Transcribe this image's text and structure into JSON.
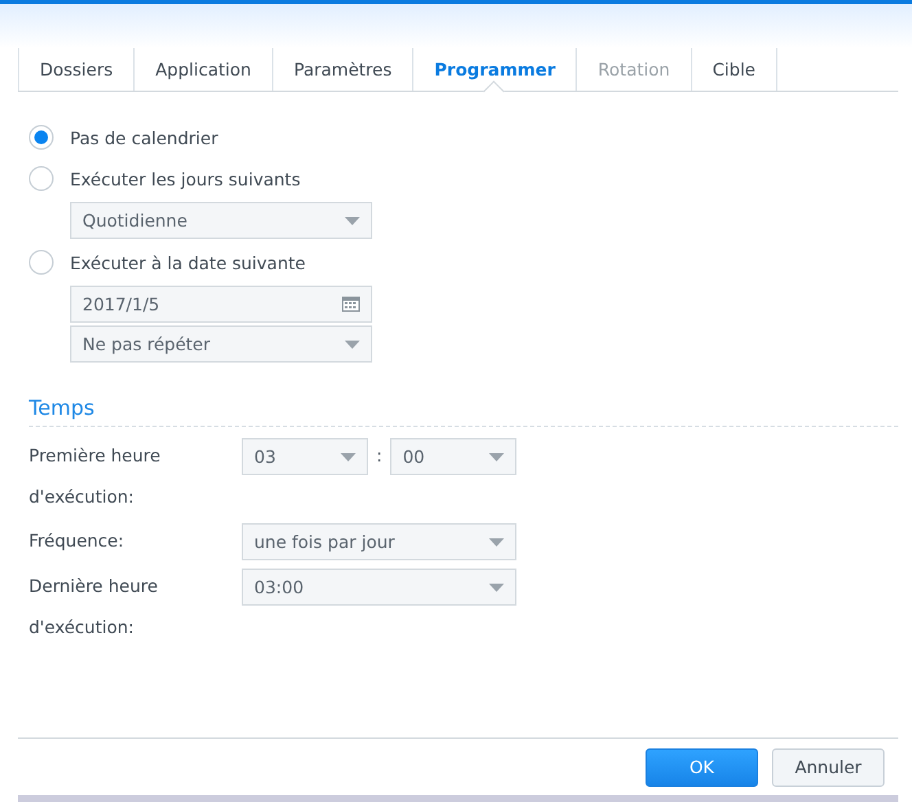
{
  "tabs": [
    {
      "label": "Dossiers",
      "selected": false,
      "disabled": false
    },
    {
      "label": "Application",
      "selected": false,
      "disabled": false
    },
    {
      "label": "Paramètres",
      "selected": false,
      "disabled": false
    },
    {
      "label": "Programmer",
      "selected": true,
      "disabled": false
    },
    {
      "label": "Rotation",
      "selected": false,
      "disabled": true
    },
    {
      "label": "Cible",
      "selected": false,
      "disabled": false
    }
  ],
  "schedule": [
    {
      "label": "Pas de calendrier",
      "selected": true
    },
    {
      "label": "Exécuter les jours suivants",
      "selected": false,
      "fields": [
        {
          "kind": "dropdown",
          "value": "Quotidienne"
        }
      ]
    },
    {
      "label": "Exécuter à la date suivante",
      "selected": false,
      "fields": [
        {
          "kind": "date",
          "value": "2017/1/5"
        },
        {
          "kind": "dropdown",
          "value": "Ne pas répéter"
        }
      ]
    }
  ],
  "time": {
    "title": "Temps",
    "rows": [
      {
        "label": "Première heure d'exécution:",
        "kind": "pair",
        "hour": "03",
        "separator": ":",
        "minute": "00"
      },
      {
        "label": "Fréquence:",
        "kind": "single",
        "value": "une fois par jour"
      },
      {
        "label": "Dernière heure d'exécution:",
        "kind": "single",
        "value": "03:00"
      }
    ]
  },
  "buttons": [
    {
      "label": "OK",
      "kind": "primary"
    },
    {
      "label": "Annuler",
      "kind": "secondary"
    }
  ]
}
